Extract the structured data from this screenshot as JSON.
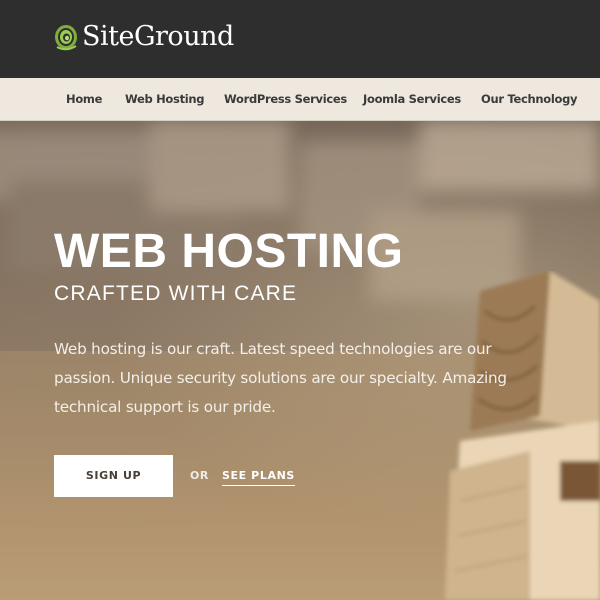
{
  "header": {
    "logo_text": "SiteGround",
    "logo_icon": "siteground-spiral-logo",
    "background": "#2e2e2e"
  },
  "nav": {
    "items": [
      {
        "label": "Home"
      },
      {
        "label": "Web Hosting"
      },
      {
        "label": "WordPress Services"
      },
      {
        "label": "Joomla Services"
      },
      {
        "label": "Our Technology"
      }
    ],
    "background": "#eee8df"
  },
  "hero": {
    "title": "WEB HOSTING",
    "subtitle": "CRAFTED WITH CARE",
    "description_lines": [
      "Web hosting is our craft. Latest speed technologies are our",
      "passion. Unique security solutions are our specialty. Amazing",
      "technical support is our pride."
    ],
    "signup_label": "SIGN UP",
    "or_label": "OR",
    "see_plans_label": "SEE PLANS"
  },
  "colors": {
    "accent_logo_green": "#8dbf4a",
    "button_bg": "#ffffff"
  }
}
